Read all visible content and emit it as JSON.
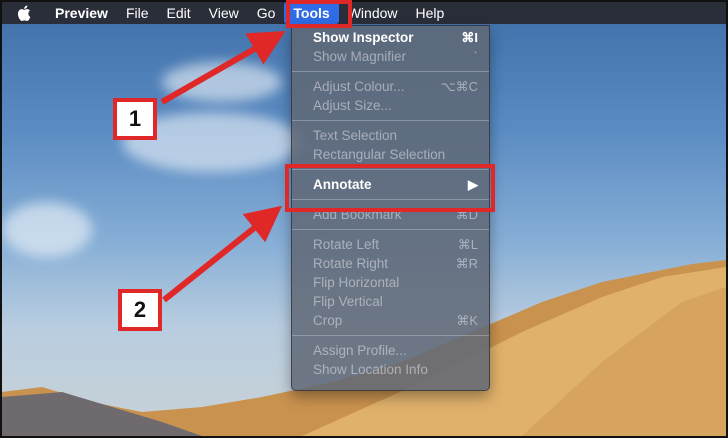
{
  "menubar": {
    "items": [
      "Preview",
      "File",
      "Edit",
      "View",
      "Go",
      "Tools",
      "Window",
      "Help"
    ],
    "active": "Tools"
  },
  "tools_menu": {
    "show_inspector": {
      "label": "Show Inspector",
      "shortcut": "⌘I"
    },
    "show_magnifier": {
      "label": "Show Magnifier",
      "shortcut": "`"
    },
    "adjust_colour": {
      "label": "Adjust Colour...",
      "shortcut": "⌥⌘C"
    },
    "adjust_size": {
      "label": "Adjust Size..."
    },
    "text_selection": {
      "label": "Text Selection"
    },
    "rectangular_selection": {
      "label": "Rectangular Selection"
    },
    "annotate": {
      "label": "Annotate",
      "submenu_arrow": "▶"
    },
    "add_bookmark": {
      "label": "Add Bookmark",
      "shortcut": "⌘D"
    },
    "rotate_left": {
      "label": "Rotate Left",
      "shortcut": "⌘L"
    },
    "rotate_right": {
      "label": "Rotate Right",
      "shortcut": "⌘R"
    },
    "flip_horizontal": {
      "label": "Flip Horizontal"
    },
    "flip_vertical": {
      "label": "Flip Vertical"
    },
    "crop": {
      "label": "Crop",
      "shortcut": "⌘K"
    },
    "assign_profile": {
      "label": "Assign Profile..."
    },
    "show_location_info": {
      "label": "Show Location Info"
    }
  },
  "callouts": {
    "step1": "1",
    "step2": "2",
    "color": "#e02828"
  },
  "icons": {
    "apple": "apple-icon"
  }
}
